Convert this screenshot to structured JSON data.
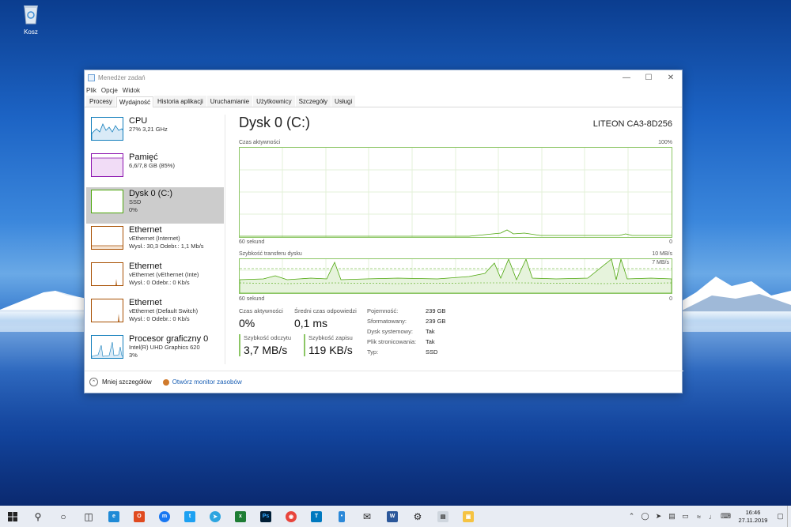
{
  "desktop": {
    "recycle_bin_label": "Kosz"
  },
  "window": {
    "title": "Menedżer zadań",
    "menu": [
      "Plik",
      "Opcje",
      "Widok"
    ],
    "tabs": [
      "Procesy",
      "Wydajność",
      "Historia aplikacji",
      "Uruchamianie",
      "Użytkownicy",
      "Szczegóły",
      "Usługi"
    ],
    "active_tab": "Wydajność"
  },
  "sidebar": {
    "items": [
      {
        "title": "CPU",
        "line1": "27%  3,21 GHz",
        "line2": "",
        "color": "#117dbb"
      },
      {
        "title": "Pamięć",
        "line1": "6,6/7,8 GB (85%)",
        "line2": "",
        "color": "#8b12ae"
      },
      {
        "title": "Dysk 0 (C:)",
        "line1": "SSD",
        "line2": "0%",
        "color": "#4da60c"
      },
      {
        "title": "Ethernet",
        "line1": "vEthernet (Internet)",
        "line2": "Wysł.: 30,3  Odebr.: 1,1 Mb/s",
        "color": "#a74f01"
      },
      {
        "title": "Ethernet",
        "line1": "vEthernet (vEthernet (Inte)",
        "line2": "Wysł.: 0  Odebr.: 0 Kb/s",
        "color": "#a74f01"
      },
      {
        "title": "Ethernet",
        "line1": "vEthernet (Default Switch)",
        "line2": "Wysł.: 0  Odebr.: 0 Kb/s",
        "color": "#a74f01"
      },
      {
        "title": "Procesor graficzny 0",
        "line1": "Intel(R) UHD Graphics 620",
        "line2": "3%",
        "color": "#117dbb"
      }
    ]
  },
  "main": {
    "title": "Dysk 0 (C:)",
    "model": "LITEON CA3-8D256",
    "graph1": {
      "label": "Czas aktywności",
      "max": "100%",
      "time": "60 sekund",
      "min": "0"
    },
    "graph2": {
      "label": "Szybkość transferu dysku",
      "max": "10 MB/s",
      "inner": "7 MB/s",
      "time": "60 sekund",
      "min": "0"
    }
  },
  "stats": {
    "active_time_label": "Czas aktywności",
    "active_time": "0%",
    "resp_label": "Średni czas odpowiedzi",
    "resp": "0,1 ms",
    "read_label": "Szybkość odczytu",
    "read": "3,7 MB/s",
    "write_label": "Szybkość zapisu",
    "write": "119 KB/s",
    "props": [
      {
        "k": "Pojemność:",
        "v": "239 GB"
      },
      {
        "k": "Sformatowany:",
        "v": "239 GB"
      },
      {
        "k": "Dysk systemowy:",
        "v": "Tak"
      },
      {
        "k": "Plik stronicowania:",
        "v": "Tak"
      },
      {
        "k": "Typ:",
        "v": "SSD"
      }
    ]
  },
  "footer": {
    "less": "Mniej szczegółów",
    "monitor": "Otwórz monitor zasobów"
  },
  "taskbar": {
    "time": "16:46",
    "date": "27.11.2019"
  },
  "colors": {
    "disk_green": "#4da60c",
    "graph_border": "#8cc665"
  }
}
